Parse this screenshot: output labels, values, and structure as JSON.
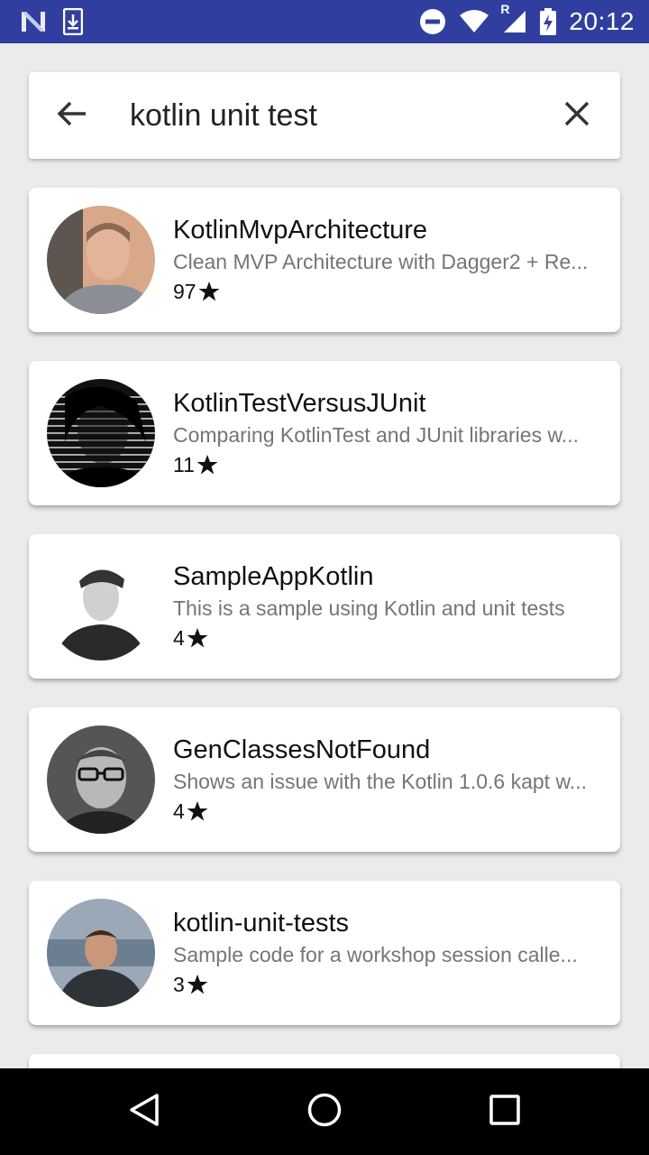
{
  "status_bar": {
    "time": "20:12",
    "roaming_indicator": "R",
    "icons": [
      "n-notification-icon",
      "download-icon",
      "do-not-disturb-icon",
      "wifi-icon",
      "signal-icon",
      "battery-charging-icon"
    ]
  },
  "search": {
    "query": "kotlin unit test",
    "back_icon": "arrow-back-icon",
    "clear_icon": "close-icon"
  },
  "results": [
    {
      "name": "KotlinMvpArchitecture",
      "description": "Clean MVP Architecture with Dagger2 + Re...",
      "stars": "97",
      "avatar_color": "#c89a7a"
    },
    {
      "name": "KotlinTestVersusJUnit",
      "description": "Comparing KotlinTest and JUnit libraries w...",
      "stars": "11",
      "avatar_color": "#222222"
    },
    {
      "name": "SampleAppKotlin",
      "description": "This is a sample using Kotlin and unit tests",
      "stars": "4",
      "avatar_color": "#444444"
    },
    {
      "name": "GenClassesNotFound",
      "description": "Shows an issue with the Kotlin 1.0.6 kapt w...",
      "stars": "4",
      "avatar_color": "#5a5a5a"
    },
    {
      "name": "kotlin-unit-tests",
      "description": "Sample code for a workshop session calle...",
      "stars": "3",
      "avatar_color": "#7a8a9a"
    }
  ],
  "nav_bar": {
    "back_icon": "nav-back-icon",
    "home_icon": "nav-home-icon",
    "recents_icon": "nav-recents-icon"
  },
  "colors": {
    "status_bar": "#303f9f",
    "background": "#ebebeb",
    "card": "#ffffff",
    "secondary_text": "#757575"
  }
}
